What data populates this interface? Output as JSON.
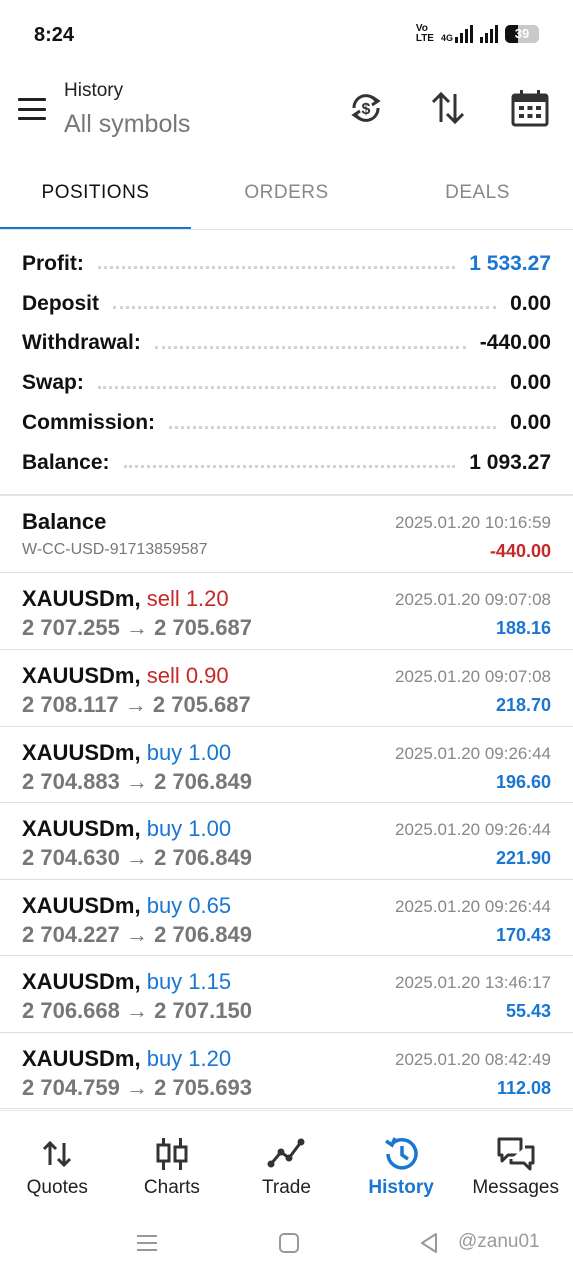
{
  "status_bar": {
    "time": "8:24",
    "network_line1": "Vo",
    "network_line2": "LTE",
    "network_type": "4G",
    "battery": "39"
  },
  "header": {
    "title": "History",
    "subtitle": "All symbols",
    "icons": [
      "currency-refresh-icon",
      "sort-icon",
      "calendar-icon"
    ]
  },
  "tabs": [
    {
      "label": "POSITIONS",
      "active": true
    },
    {
      "label": "ORDERS",
      "active": false
    },
    {
      "label": "DEALS",
      "active": false
    }
  ],
  "summary": {
    "profit_label": "Profit:",
    "profit_value": "1 533.27",
    "deposit_label": "Deposit",
    "deposit_value": "0.00",
    "withdrawal_label": "Withdrawal:",
    "withdrawal_value": "-440.00",
    "swap_label": "Swap:",
    "swap_value": "0.00",
    "commission_label": "Commission:",
    "commission_value": "0.00",
    "balance_label": "Balance:",
    "balance_value": "1 093.27"
  },
  "balance_entry": {
    "title": "Balance",
    "reference": "W-CC-USD-91713859587",
    "time": "2025.01.20 10:16:59",
    "amount": "-440.00"
  },
  "deals": [
    {
      "symbol": "XAUUSDm,",
      "direction": "sell 1.20",
      "type": "sell",
      "prices": "2 707.255 → 2 705.687",
      "time": "2025.01.20 09:07:08",
      "profit": "188.16"
    },
    {
      "symbol": "XAUUSDm,",
      "direction": "sell 0.90",
      "type": "sell",
      "prices": "2 708.117 → 2 705.687",
      "time": "2025.01.20 09:07:08",
      "profit": "218.70"
    },
    {
      "symbol": "XAUUSDm,",
      "direction": "buy 1.00",
      "type": "buy",
      "prices": "2 704.883 → 2 706.849",
      "time": "2025.01.20 09:26:44",
      "profit": "196.60"
    },
    {
      "symbol": "XAUUSDm,",
      "direction": "buy 1.00",
      "type": "buy",
      "prices": "2 704.630 → 2 706.849",
      "time": "2025.01.20 09:26:44",
      "profit": "221.90"
    },
    {
      "symbol": "XAUUSDm,",
      "direction": "buy 0.65",
      "type": "buy",
      "prices": "2 704.227 → 2 706.849",
      "time": "2025.01.20 09:26:44",
      "profit": "170.43"
    },
    {
      "symbol": "XAUUSDm,",
      "direction": "buy 1.15",
      "type": "buy",
      "prices": "2 706.668 → 2 707.150",
      "time": "2025.01.20 13:46:17",
      "profit": "55.43"
    },
    {
      "symbol": "XAUUSDm,",
      "direction": "buy 1.20",
      "type": "buy",
      "prices": "2 704.759 → 2 705.693",
      "time": "2025.01.20 08:42:49",
      "profit": "112.08"
    }
  ],
  "bottom_nav": [
    {
      "label": "Quotes",
      "icon": "quotes-icon",
      "active": false
    },
    {
      "label": "Charts",
      "icon": "charts-icon",
      "active": false
    },
    {
      "label": "Trade",
      "icon": "trade-icon",
      "active": false
    },
    {
      "label": "History",
      "icon": "history-icon",
      "active": true
    },
    {
      "label": "Messages",
      "icon": "messages-icon",
      "active": false
    }
  ],
  "watermark": "@zanu01",
  "colors": {
    "accent_blue": "#1976d2",
    "sell_red": "#c62828",
    "text_gray": "#777777"
  }
}
